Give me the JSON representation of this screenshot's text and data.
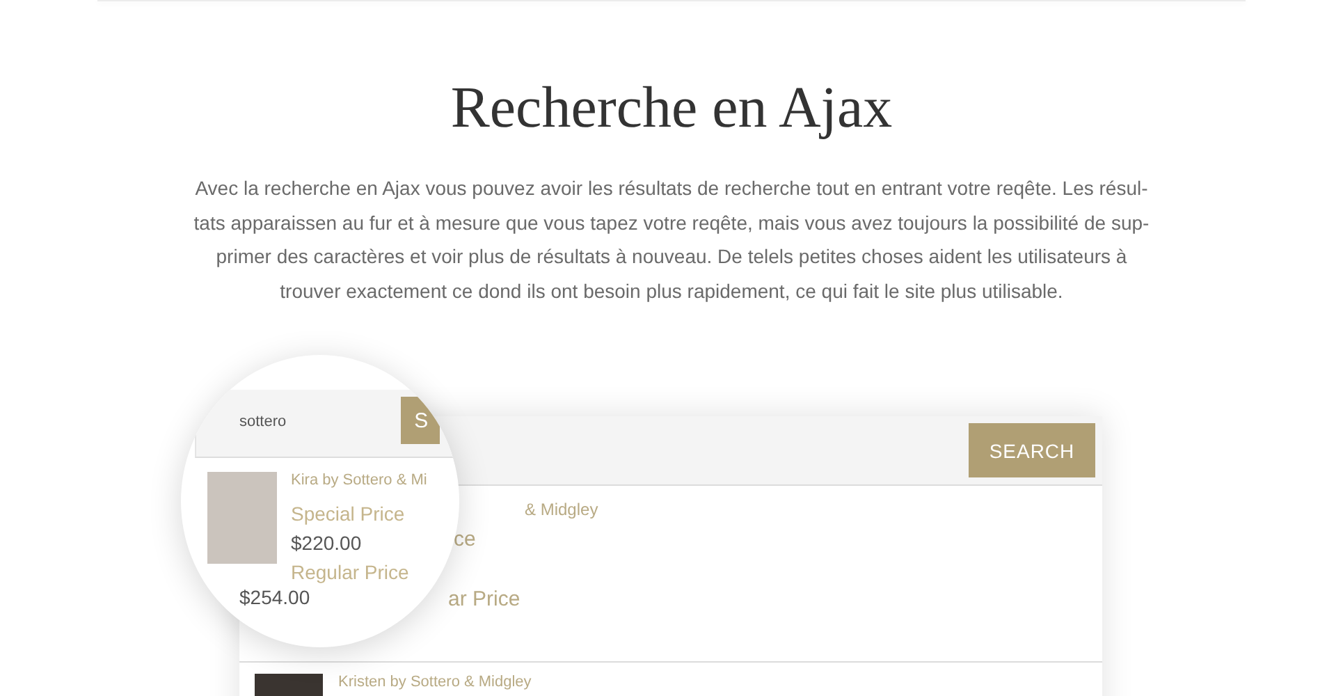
{
  "title": "Recherche en Ajax",
  "description": {
    "lines": [
      "Avec la recherche en Ajax vous pouvez avoir les résultats de recherche tout en entrant votre reqête. Les résul-",
      "tats apparaissen au fur et à mesure que vous tapez votre reqête, mais vous avez toujours la possibilité de sup-",
      "primer des caractères et voir plus de résultats à nouveau. De telels petites choses aident les utilisateurs à",
      "trouver exactement ce dond ils ont besoin plus rapidement, ce qui fait le site  plus utilisable."
    ]
  },
  "search": {
    "button": "SEARCH"
  },
  "results": [
    {
      "kind": "partial",
      "name_fragment": "& Midgley",
      "label_fragment": "ce",
      "regular_fragment": "ar Price"
    },
    {
      "kind": "full",
      "name": "Kristen by Sottero & Midgley"
    }
  ],
  "magnifier": {
    "query": "sottero",
    "button": "S",
    "result": {
      "name": "Kira by Sottero & Mi",
      "special_label": "Special Price",
      "special_price": "$220.00",
      "regular_label": "Regular Price",
      "regular_price": "$254.00"
    }
  }
}
